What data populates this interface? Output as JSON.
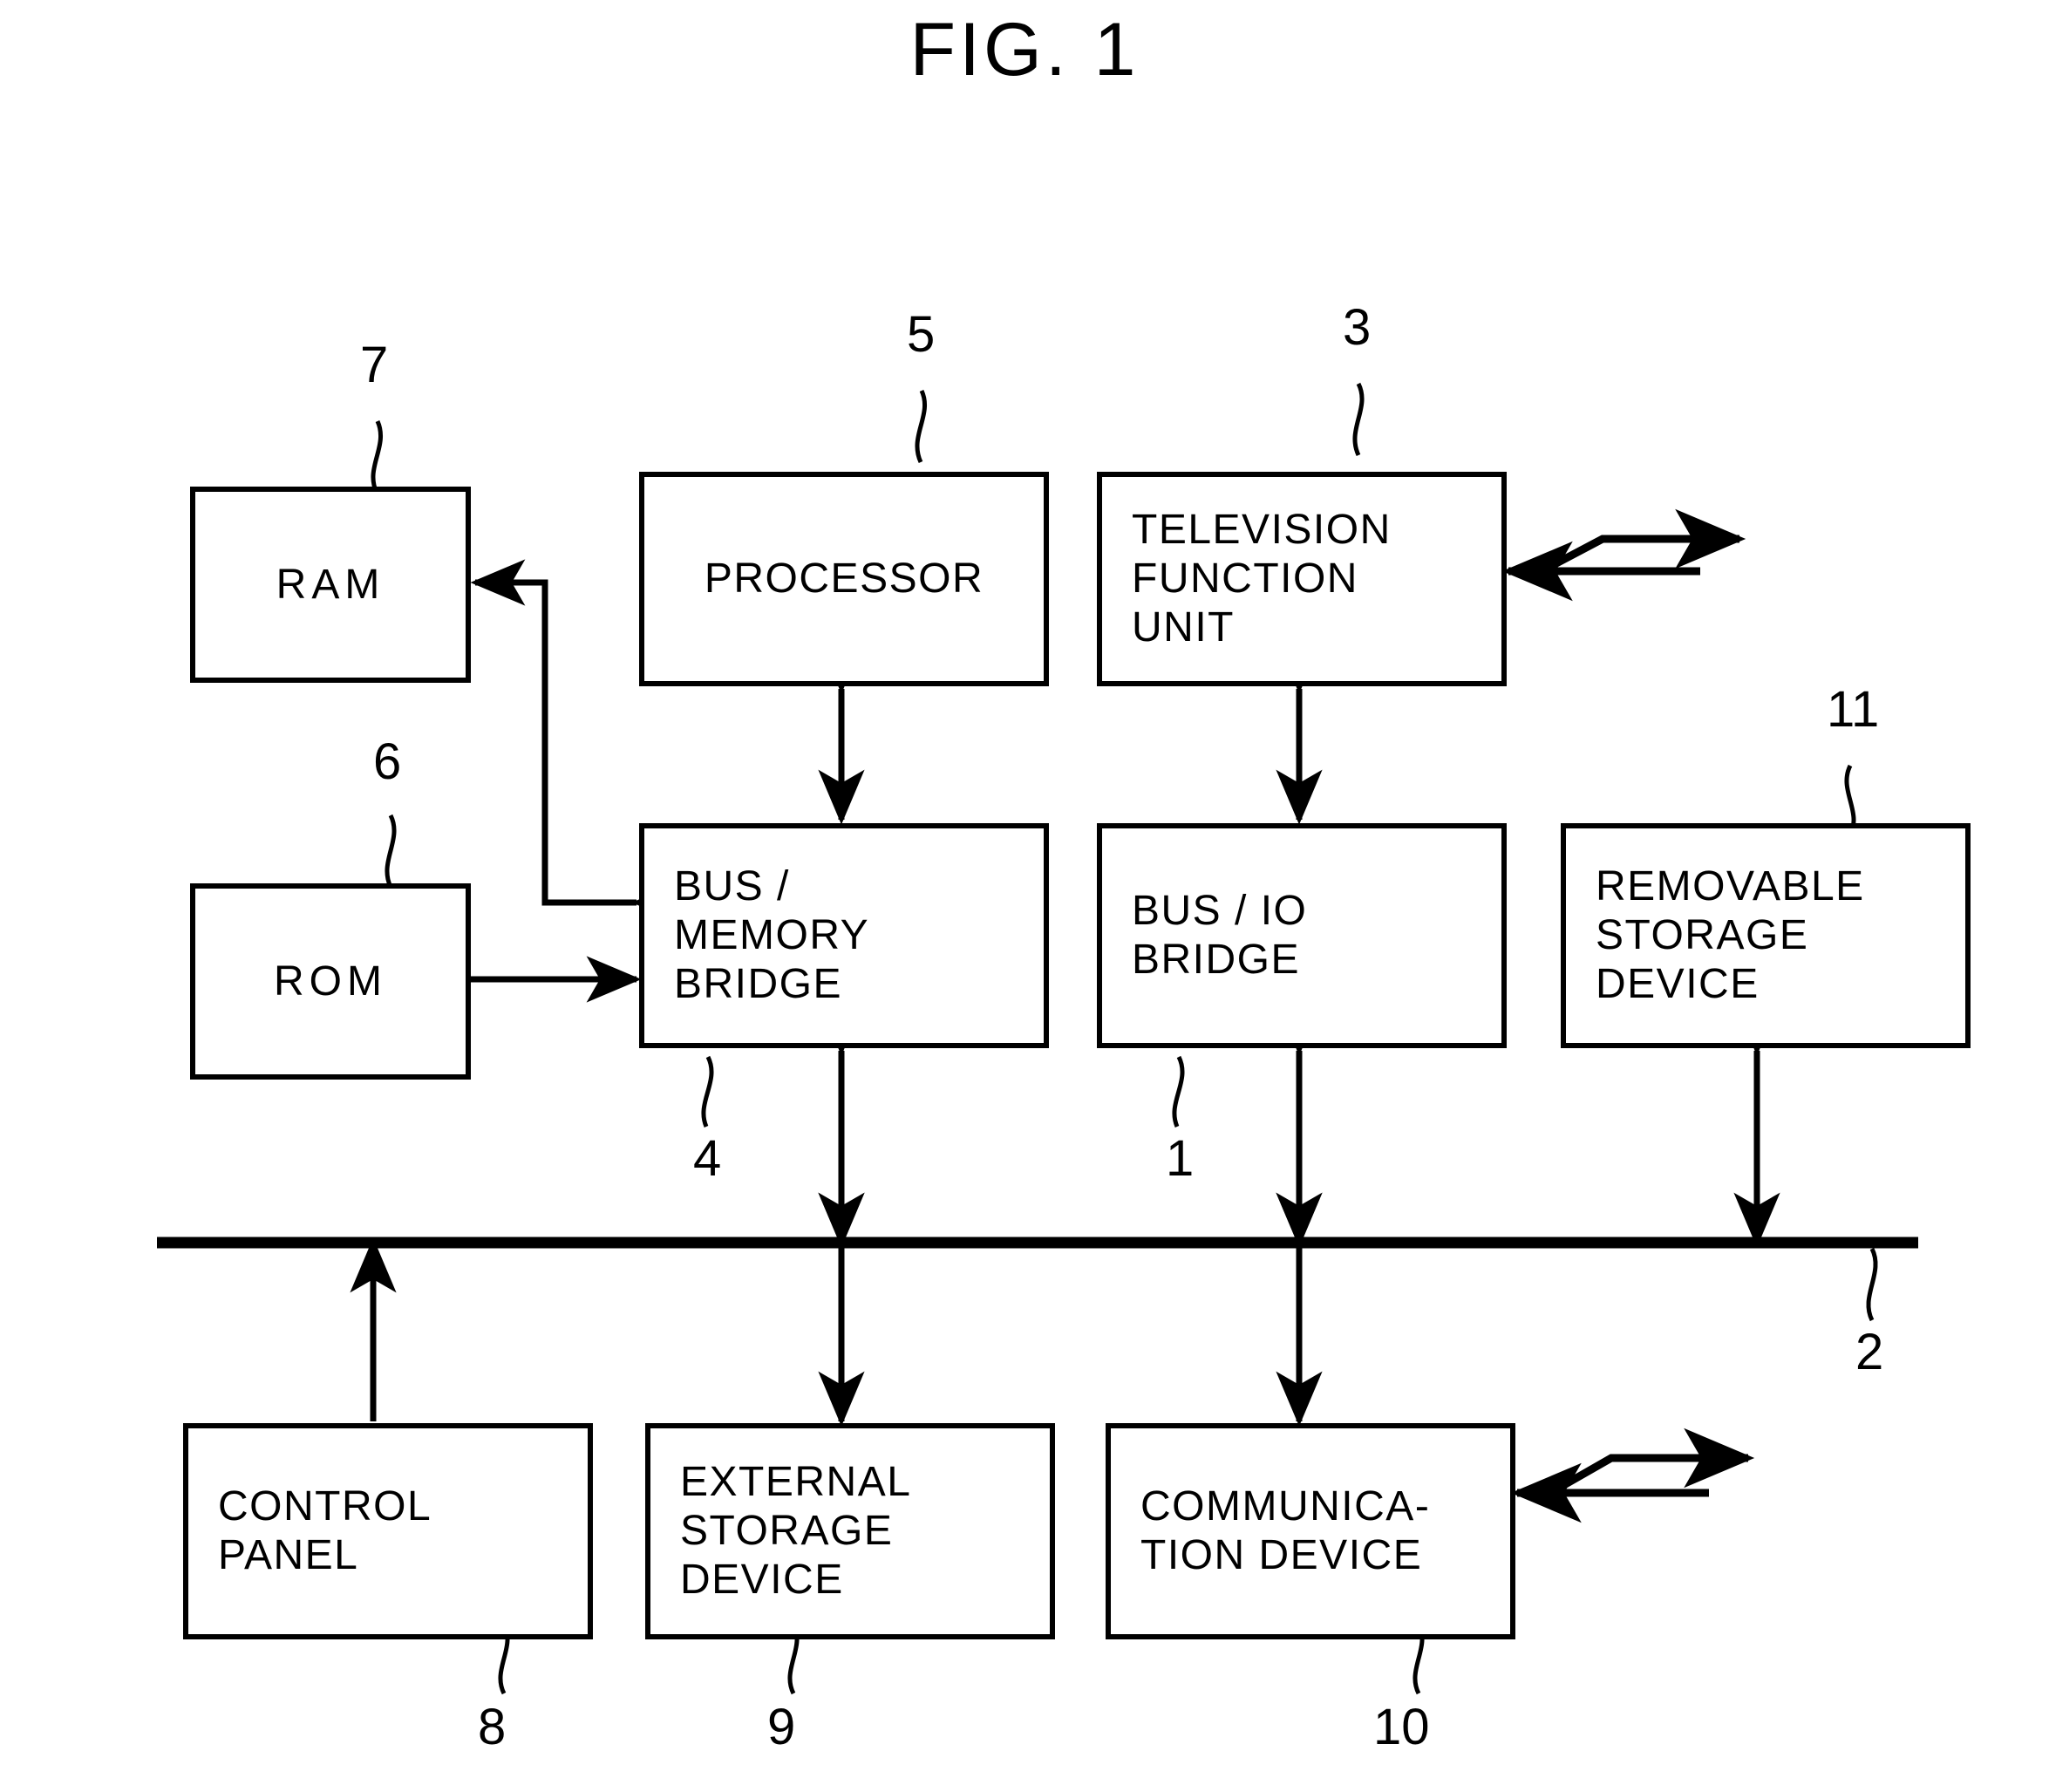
{
  "figure": {
    "title": "FIG. 1",
    "type": "patent-block-diagram"
  },
  "nodes": [
    {
      "id": "ram",
      "label": "RAM",
      "ref": "7"
    },
    {
      "id": "rom",
      "label": "ROM",
      "ref": "6"
    },
    {
      "id": "processor",
      "label": "PROCESSOR",
      "ref": "5"
    },
    {
      "id": "television",
      "label": "TELEVISION\nFUNCTION\nUNIT",
      "ref": "3"
    },
    {
      "id": "bus-memory-bridge",
      "label": "BUS /\nMEMORY\nBRIDGE",
      "ref": "4"
    },
    {
      "id": "bus-io-bridge",
      "label": "BUS / IO\nBRIDGE",
      "ref": "1"
    },
    {
      "id": "removable-storage",
      "label": "REMOVABLE\nSTORAGE\nDEVICE",
      "ref": "11"
    },
    {
      "id": "control-panel",
      "label": "CONTROL\nPANEL",
      "ref": "8"
    },
    {
      "id": "external-storage",
      "label": "EXTERNAL\nSTORAGE\nDEVICE",
      "ref": "9"
    },
    {
      "id": "communication",
      "label": "COMMUNICA-\nTION  DEVICE",
      "ref": "10"
    }
  ],
  "bus": {
    "id": "system-bus",
    "ref": "2"
  },
  "reference_numerals": {
    "ram": "7",
    "rom": "6",
    "processor": "5",
    "television_function_unit": "3",
    "bus_memory_bridge": "4",
    "bus_io_bridge": "1",
    "removable_storage_device": "11",
    "control_panel": "8",
    "external_storage_device": "9",
    "communication_device": "10",
    "bus": "2"
  },
  "colors": {
    "stroke": "#000000",
    "background": "#ffffff"
  }
}
